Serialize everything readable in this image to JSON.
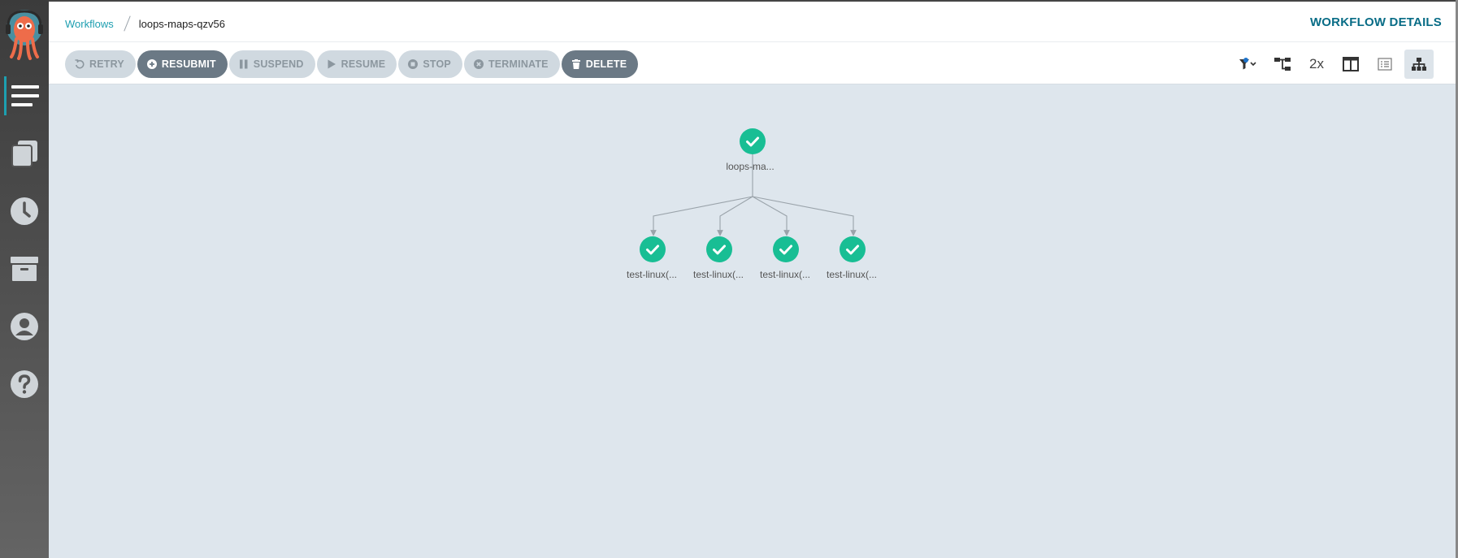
{
  "header": {
    "breadcrumb": {
      "parent": "Workflows",
      "current": "loops-maps-qzv56"
    },
    "title": "WORKFLOW DETAILS"
  },
  "sidebar": {
    "items": [
      {
        "icon": "workflows-icon",
        "active": true
      },
      {
        "icon": "workflow-templates-icon",
        "active": false
      },
      {
        "icon": "cron-workflows-icon",
        "active": false
      },
      {
        "icon": "archive-icon",
        "active": false
      },
      {
        "icon": "user-icon",
        "active": false
      },
      {
        "icon": "help-icon",
        "active": false
      }
    ]
  },
  "toolbar": {
    "retry": "RETRY",
    "resubmit": "RESUBMIT",
    "suspend": "SUSPEND",
    "resume": "RESUME",
    "stop": "STOP",
    "terminate": "TERMINATE",
    "delete": "DELETE",
    "zoom": "2x"
  },
  "graph": {
    "root": {
      "label": "loops-ma...",
      "status": "succeeded"
    },
    "children": [
      {
        "label": "test-linux(...",
        "status": "succeeded"
      },
      {
        "label": "test-linux(...",
        "status": "succeeded"
      },
      {
        "label": "test-linux(...",
        "status": "succeeded"
      },
      {
        "label": "test-linux(...",
        "status": "succeeded"
      }
    ]
  },
  "colors": {
    "accent": "#1d9eb0",
    "title": "#086c86",
    "success": "#18be94",
    "canvas": "#dee6ed"
  }
}
